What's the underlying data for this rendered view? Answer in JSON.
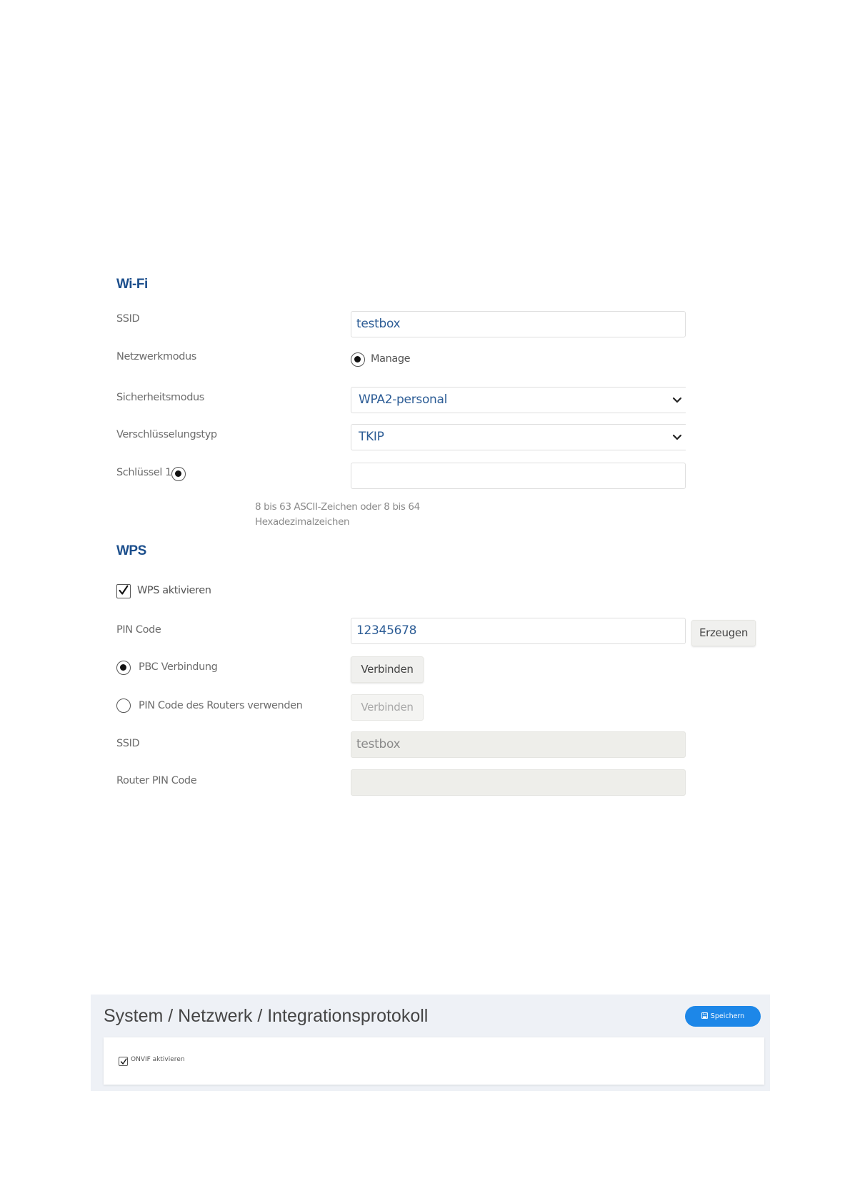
{
  "wifi": {
    "title": "Wi-Fi",
    "ssid_label": "SSID",
    "ssid_value": "testbox",
    "mode_label": "Netzwerkmodus",
    "mode_option": "Manage",
    "security_label": "Sicherheitsmodus",
    "security_value": "WPA2-personal",
    "encryption_label": "Verschlüsselungstyp",
    "encryption_value": "TKIP",
    "key_label": "Schlüssel 1",
    "key_value": "",
    "hint": "8 bis 63 ASCII-Zeichen oder 8 bis 64 Hexadezimalzeichen"
  },
  "wps": {
    "title": "WPS",
    "enable_label": "WPS aktivieren",
    "enable_checked": true,
    "pin_label": "PIN Code",
    "pin_value": "12345678",
    "generate_button": "Erzeugen",
    "pbc_label": "PBC Verbindung",
    "pbc_button": "Verbinden",
    "router_pin_option_label": "PIN Code des Routers verwenden",
    "router_pin_button": "Verbinden",
    "ssid_label": "SSID",
    "ssid_value": "testbox",
    "router_pin_label": "Router PIN Code",
    "router_pin_value": ""
  },
  "onvif_panel": {
    "breadcrumb": "System / Netzwerk / Integrationsprotokoll",
    "save_button": "Speichern",
    "onvif_label": "ONVIF aktivieren",
    "onvif_checked": true,
    "accent_color": "#1d87e8"
  },
  "icons": {
    "select_arrow": "chevron-down-icon",
    "check": "checkmark-icon",
    "save": "floppy-disk-icon"
  },
  "colors": {
    "section_title": "#1b4e8c",
    "field_text": "#2d5d96",
    "disabled_field_bg": "#eeeeea"
  }
}
